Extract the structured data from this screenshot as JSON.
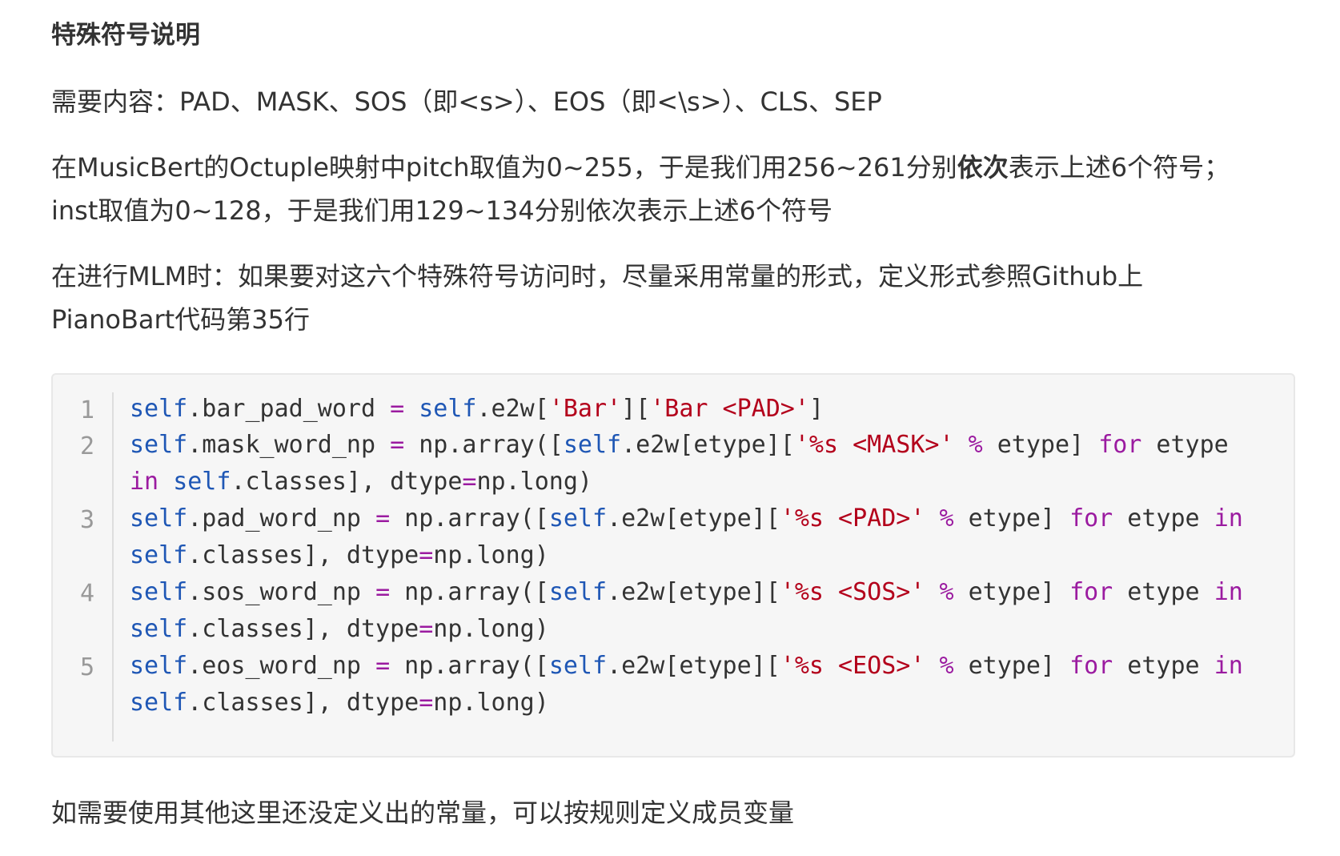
{
  "heading": "特殊符号说明",
  "paragraphs": {
    "p1": "需要内容：PAD、MASK、SOS（即<s>）、EOS（即<\\s>）、CLS、SEP",
    "p2_before_bold": "在MusicBert的Octuple映射中pitch取值为0~255，于是我们用256~261分别",
    "p2_bold": "依次",
    "p2_after_bold": "表示上述6个符号；",
    "p2_line2": "inst取值为0~128，于是我们用129~134分别依次表示上述6个符号",
    "p3_line1": "在进行MLM时：如果要对这六个特殊符号访问时，尽量采用常量的形式，定义形式参照Github上",
    "p3_line2": "PianoBart代码第35行",
    "p4": "如需要使用其他这里还没定义出的常量，可以按规则定义成员变量"
  },
  "code": {
    "language": "python",
    "lines": [
      {
        "number": "1",
        "text": "self.bar_pad_word = self.e2w['Bar']['Bar <PAD>']"
      },
      {
        "number": "2",
        "text": "self.mask_word_np = np.array([self.e2w[etype]['%s <MASK>' % etype] for etype in self.classes], dtype=np.long)"
      },
      {
        "number": "3",
        "text": "self.pad_word_np = np.array([self.e2w[etype]['%s <PAD>' % etype] for etype in self.classes], dtype=np.long)"
      },
      {
        "number": "4",
        "text": "self.sos_word_np = np.array([self.e2w[etype]['%s <SOS>' % etype] for etype in self.classes], dtype=np.long)"
      },
      {
        "number": "5",
        "text": "self.eos_word_np = np.array([self.e2w[etype]['%s <EOS>' % etype] for etype in self.classes], dtype=np.long)"
      }
    ]
  },
  "colors": {
    "text": "#333333",
    "code_background": "#f6f6f6",
    "keyword_self": "#1f57b5",
    "string": "#b3001b",
    "keyword": "#9b1ba0",
    "line_number": "#999999"
  }
}
